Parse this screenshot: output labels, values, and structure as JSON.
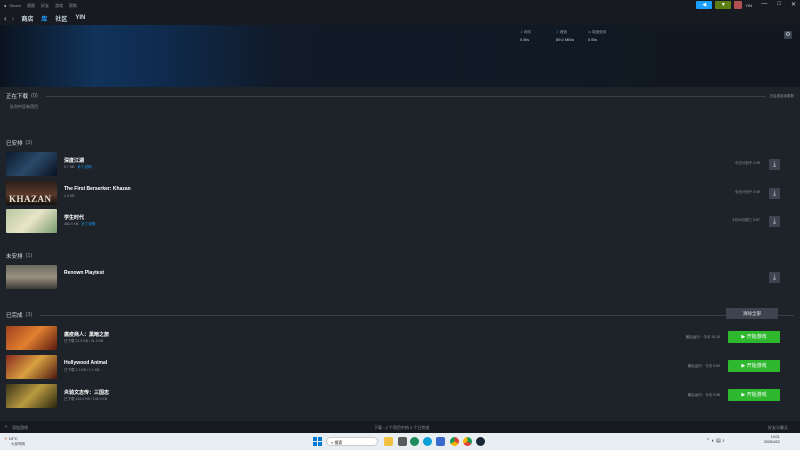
{
  "window": {
    "app_name": "Steam",
    "menu": [
      "Steam",
      "视图",
      "好友",
      "游戏",
      "帮助"
    ],
    "nav": {
      "back": "‹",
      "forward": "›",
      "items": [
        "商店",
        "库",
        "社区",
        "YIN"
      ]
    },
    "user": "YIN",
    "controls": {
      "minimize": "—",
      "maximize": "□",
      "close": "✕"
    },
    "colors": {
      "accent": "#1a9fff",
      "play": "#2eb82e",
      "bg": "#1e2329"
    }
  },
  "stats": [
    {
      "label": "网络",
      "value": "0 B/s"
    },
    {
      "label": "峰值",
      "value": "89.0 MB/s"
    },
    {
      "label": "磁盘使用",
      "value": "0 B/s"
    }
  ],
  "downloading": {
    "title": "正在下载",
    "count": "(0)",
    "empty_text": "队列中没有项目",
    "right_text": "已启用自动更新"
  },
  "scheduled": {
    "title": "已安排",
    "count": "(3)",
    "items": [
      {
        "name": "深度江湖",
        "size": "5.7 KB",
        "status": "补丁说明",
        "time": "今日计划于 4:49"
      },
      {
        "name": "The First Berserker: Khazan",
        "size": "1.0 KB",
        "status": "",
        "time": "今日计划于 4:49"
      },
      {
        "name": "学生时代",
        "size": "482.4 KB",
        "status": "补丁说明",
        "time": "4月23日周三 5:57"
      }
    ]
  },
  "unscheduled": {
    "title": "未安排",
    "count": "(1)",
    "items": [
      {
        "name": "Renown Playtest"
      }
    ]
  },
  "completed": {
    "title": "已完成",
    "count": "(3)",
    "clear_label": "清除全部",
    "items": [
      {
        "name": "瘟疫商人：黑暗之旅",
        "meta": "已下载 21.3 KB / 21.3 KB",
        "last": "最后运行：今天 10:15",
        "play": "开始游戏"
      },
      {
        "name": "Hollywood Animal",
        "meta": "已下载 1.1 KB / 1.1 KB",
        "last": "最后运行：今天 9:59",
        "play": "开始游戏"
      },
      {
        "name": "炎骑文志传：三国志",
        "meta": "已下载 134.0 KB / 134.0 KB",
        "last": "最后运行：今天 9:58",
        "play": "开始游戏"
      }
    ]
  },
  "statusbar": {
    "left": "添加游戏",
    "center": "下载 - 2 个项目中的 2 个已完成",
    "right": "好友与聊天"
  },
  "taskbar": {
    "weather": "19°C",
    "weather_sub": "大部晴朗",
    "search": "搜索",
    "time": "14:01",
    "date": "2025/4/23"
  }
}
